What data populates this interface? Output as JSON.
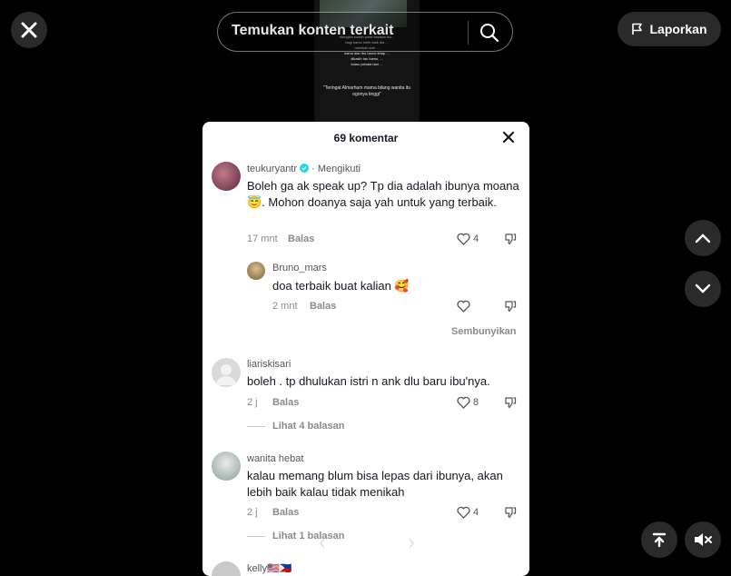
{
  "video": {
    "text": "mungkin sudah pasti kepada ibu...\nbagi kamu lebih baik dia ...\nmenikah kah ...\nkamu dan ibu harus tetap ...\ndikasih tau kamu, ...\nkalau pahala dari ...",
    "caption": "\"Teringat Almarhum mama bilang wanita itu egonya tinggi\""
  },
  "search": {
    "placeholder": "Temukan konten terkait"
  },
  "report": {
    "label": "Laporkan"
  },
  "panel": {
    "title": "69 komentar",
    "comments": [
      {
        "username": "teukuryantr",
        "verified": true,
        "follow": "· Mengikuti",
        "text": "Boleh ga ak speak up? Tp dia adalah ibunya moana😇. Mohon doanya saja yah untuk yang terbaik.",
        "time": "17 mnt",
        "reply": "Balas",
        "likes": "4"
      },
      {
        "username": "Bruno_mars",
        "text": "doa terbaik buat kalian 🥰",
        "time": "2 mnt",
        "reply": "Balas",
        "likes": ""
      },
      {
        "username": "liariskisari",
        "text": "boleh . tp dhulukan istri n ank dlu baru ibu'nya.",
        "time": "2 j",
        "reply": "Balas",
        "likes": "8",
        "more": "Lihat 4 balasan"
      },
      {
        "username": "wanita hebat",
        "text": "kalau memang blum bisa lepas dari ibunya, akan lebih baik kalau tidak menikah",
        "time": "2 j",
        "reply": "Balas",
        "likes": "4",
        "more": "Lihat 1 balasan"
      },
      {
        "username": "kelly🇺🇸🇵🇭"
      }
    ],
    "hide": "Sembunyikan"
  }
}
